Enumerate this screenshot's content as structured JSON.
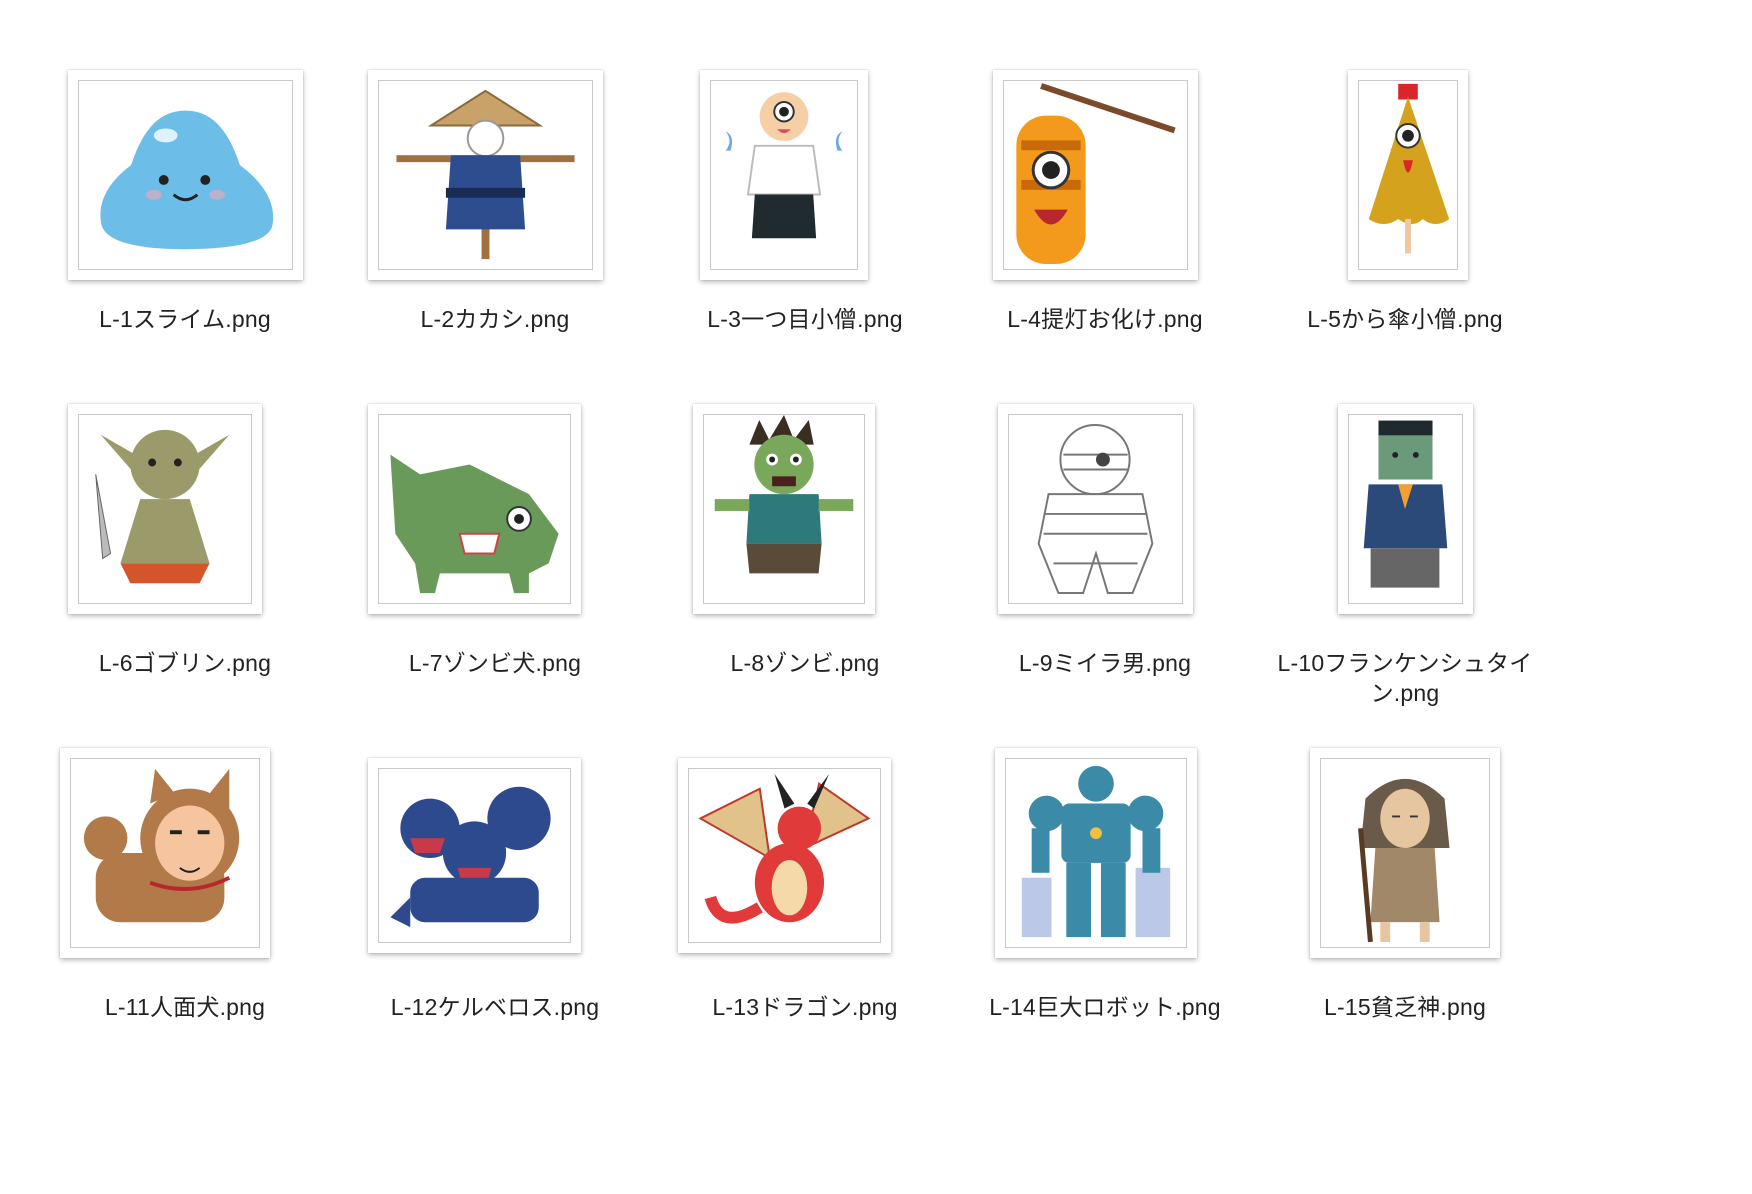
{
  "window": {
    "background": "#ffffff"
  },
  "files": [
    {
      "name": "L-1スライム.png",
      "icon": "slime-icon"
    },
    {
      "name": "L-2カカシ.png",
      "icon": "scarecrow-icon"
    },
    {
      "name": "L-3一つ目小僧.png",
      "icon": "one-eyed-monk-icon"
    },
    {
      "name": "L-4提灯お化け.png",
      "icon": "lantern-ghost-icon"
    },
    {
      "name": "L-5から傘小僧.png",
      "icon": "umbrella-ghost-icon"
    },
    {
      "name": "L-6ゴブリン.png",
      "icon": "goblin-icon"
    },
    {
      "name": "L-7ゾンビ犬.png",
      "icon": "zombie-dog-icon"
    },
    {
      "name": "L-8ゾンビ.png",
      "icon": "zombie-icon"
    },
    {
      "name": "L-9ミイラ男.png",
      "icon": "mummy-icon"
    },
    {
      "name": "L-10フランケンシュタイン.png",
      "name_line1": "L-10フランケンシュタイ",
      "name_line2": "ン.png",
      "icon": "frankenstein-icon"
    },
    {
      "name": "L-11人面犬.png",
      "icon": "human-face-dog-icon"
    },
    {
      "name": "L-12ケルベロス.png",
      "icon": "cerberus-icon"
    },
    {
      "name": "L-13ドラゴン.png",
      "icon": "dragon-icon"
    },
    {
      "name": "L-14巨大ロボット.png",
      "icon": "giant-robot-icon"
    },
    {
      "name": "L-15貧乏神.png",
      "icon": "poverty-god-icon"
    }
  ]
}
